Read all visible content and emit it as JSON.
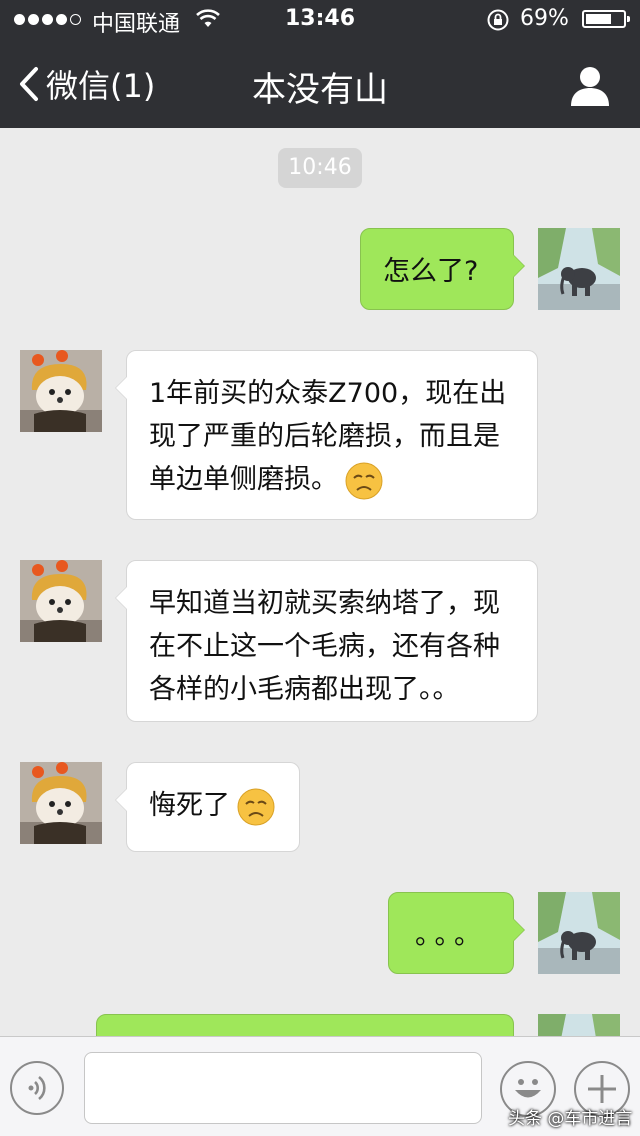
{
  "status_bar": {
    "carrier": "中国联通",
    "time": "13:46",
    "battery_percent_label": "69%",
    "battery_level": 0.69
  },
  "nav": {
    "back_label": "微信(1)",
    "title": "本没有山"
  },
  "timestamp": "10:46",
  "messages": [
    {
      "side": "out",
      "text": "怎么了?"
    },
    {
      "side": "in",
      "text": "1年前买的众泰Z700，现在出现了严重的后轮磨损，而且是单边单侧磨损。",
      "emoji": "disappointed-face"
    },
    {
      "side": "in",
      "text": "早知道当初就买索纳塔了，现在不止这一个毛病，还有各种各样的小毛病都出现了。。"
    },
    {
      "side": "in",
      "text": "悔死了",
      "emoji": "disappointed-face"
    },
    {
      "side": "out",
      "text": "。。。"
    }
  ],
  "input": {
    "value": "",
    "placeholder": ""
  },
  "watermark": "头条 @车市进言",
  "colors": {
    "nav_bg": "#2f3034",
    "chat_bg": "#ebebeb",
    "outgoing_bubble": "#9fe75a",
    "incoming_bubble": "#ffffff"
  }
}
